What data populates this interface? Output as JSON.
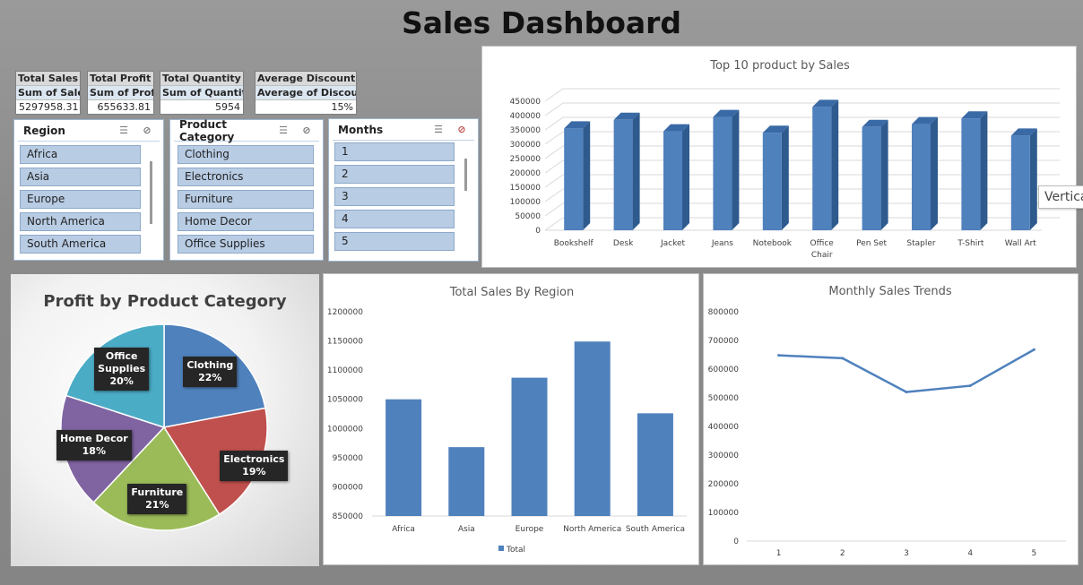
{
  "dashboard": {
    "title": "Sales Dashboard"
  },
  "kpis": [
    {
      "header": "Total Sales",
      "sub": "Sum of Sales",
      "value": "5297958.31"
    },
    {
      "header": "Total Profit",
      "sub": "Sum of Profit",
      "value": "655633.81"
    },
    {
      "header": "Total Quantity So",
      "sub": "Sum of Quantity",
      "value": "5954"
    },
    {
      "header": "Average Discount",
      "sub": "Average of Discount",
      "value": "15%"
    }
  ],
  "slicers": {
    "region": {
      "title": "Region",
      "items": [
        "Africa",
        "Asia",
        "Europe",
        "North America",
        "South America"
      ]
    },
    "category": {
      "title": "Product Category",
      "items": [
        "Clothing",
        "Electronics",
        "Furniture",
        "Home Decor",
        "Office Supplies"
      ]
    },
    "months": {
      "title": "Months",
      "items": [
        "1",
        "2",
        "3",
        "4",
        "5"
      ]
    }
  },
  "tooltip": {
    "text": "Vertica"
  },
  "colors": {
    "bar": "#4f81bd",
    "bar_dark": "#2e5a8e",
    "line": "#4f81bd",
    "pie_clothing": "#4f81bd",
    "pie_electronics": "#c0504d",
    "pie_furniture": "#9bbb59",
    "pie_homedecor": "#8064a2",
    "pie_office": "#4bacc6"
  },
  "chart_data": [
    {
      "id": "top10",
      "type": "bar",
      "title": "Top 10 product by Sales",
      "categories": [
        "Bookshelf",
        "Desk",
        "Jacket",
        "Jeans",
        "Notebook",
        "Office Chair",
        "Pen Set",
        "Stapler",
        "T-Shirt",
        "Wall Art"
      ],
      "values": [
        355000,
        385000,
        345000,
        395000,
        340000,
        430000,
        360000,
        370000,
        390000,
        330000
      ],
      "ylim": [
        0,
        450000
      ],
      "yticks": [
        "0",
        "50000",
        "100000",
        "150000",
        "200000",
        "250000",
        "300000",
        "350000",
        "400000",
        "450000"
      ],
      "xlabel": "",
      "ylabel": ""
    },
    {
      "id": "profit_pie",
      "type": "pie",
      "title": "Profit by Product Category",
      "categories": [
        "Clothing",
        "Electronics",
        "Furniture",
        "Home Decor",
        "Office Supplies"
      ],
      "values": [
        22,
        19,
        21,
        18,
        20
      ],
      "labels": [
        "22%",
        "19%",
        "21%",
        "18%",
        "20%"
      ]
    },
    {
      "id": "region_sales",
      "type": "bar",
      "title": "Total  Sales By Region",
      "categories": [
        "Africa",
        "Asia",
        "Europe",
        "North America",
        "South America"
      ],
      "series": [
        {
          "name": "Total",
          "values": [
            1050000,
            968000,
            1087000,
            1149000,
            1026000
          ]
        }
      ],
      "ylim": [
        850000,
        1200000
      ],
      "yticks": [
        "850000",
        "900000",
        "950000",
        "1000000",
        "1050000",
        "1100000",
        "1150000",
        "1200000"
      ],
      "legend": "bottom"
    },
    {
      "id": "monthly",
      "type": "line",
      "title": "Monthly Sales Trends",
      "x": [
        "1",
        "2",
        "3",
        "4",
        "5"
      ],
      "values": [
        648000,
        638000,
        520000,
        542000,
        668000
      ],
      "ylim": [
        0,
        800000
      ],
      "yticks": [
        "0",
        "100000",
        "200000",
        "300000",
        "400000",
        "500000",
        "600000",
        "700000",
        "800000"
      ]
    }
  ]
}
